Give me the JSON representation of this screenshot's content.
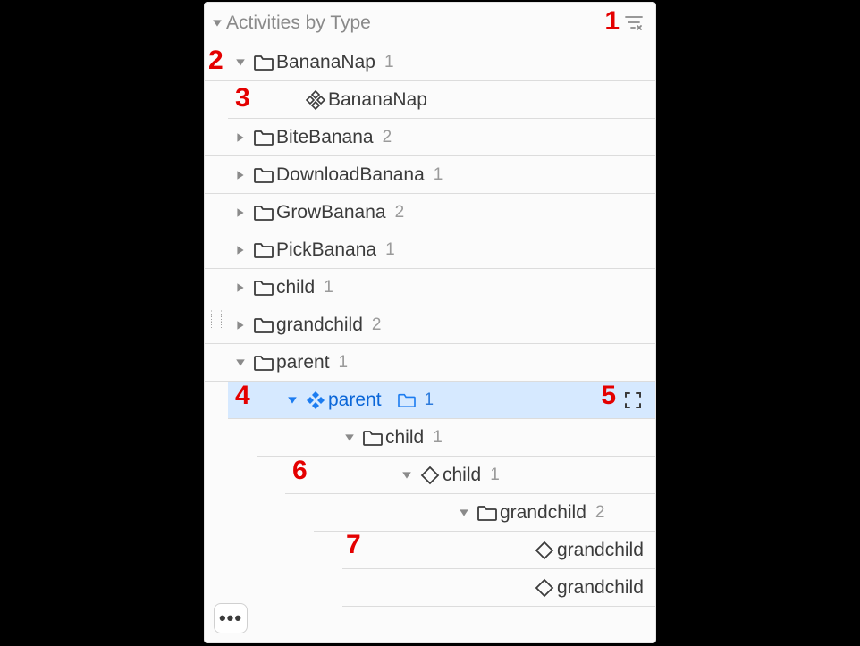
{
  "header": {
    "title": "Activities by Type"
  },
  "annotations": {
    "n1": "1",
    "n2": "2",
    "n3": "3",
    "n4": "4",
    "n5": "5",
    "n6": "6",
    "n7": "7"
  },
  "more_label": "•••",
  "rows": [
    {
      "indent": 28,
      "disclosure": "down",
      "icon": "folder",
      "label": "BananaNap",
      "count": "1"
    },
    {
      "indent": 60,
      "disclosure": "none",
      "icon": "diamond4",
      "label": "BananaNap",
      "count": ""
    },
    {
      "indent": 28,
      "disclosure": "right",
      "icon": "folder",
      "label": "BiteBanana",
      "count": "2"
    },
    {
      "indent": 28,
      "disclosure": "right",
      "icon": "folder",
      "label": "DownloadBanana",
      "count": "1"
    },
    {
      "indent": 28,
      "disclosure": "right",
      "icon": "folder",
      "label": "GrowBanana",
      "count": "2"
    },
    {
      "indent": 28,
      "disclosure": "right",
      "icon": "folder",
      "label": "PickBanana",
      "count": "1"
    },
    {
      "indent": 28,
      "disclosure": "right",
      "icon": "folder",
      "label": "child",
      "count": "1"
    },
    {
      "indent": 28,
      "disclosure": "right",
      "icon": "folder",
      "label": "grandchild",
      "count": "2"
    },
    {
      "indent": 28,
      "disclosure": "down",
      "icon": "folder",
      "label": "parent",
      "count": "1"
    },
    {
      "indent": 60,
      "disclosure": "down",
      "icon": "diamond4",
      "label": "parent",
      "count": "1",
      "selected": true,
      "trailing_folder_before_count": true,
      "focus": true
    },
    {
      "indent": 92,
      "disclosure": "down",
      "icon": "folder",
      "label": "child",
      "count": "1"
    },
    {
      "indent": 124,
      "disclosure": "down",
      "icon": "diamond",
      "label": "child",
      "count": "1"
    },
    {
      "indent": 156,
      "disclosure": "down",
      "icon": "folder",
      "label": "grandchild",
      "count": "2"
    },
    {
      "indent": 188,
      "disclosure": "none",
      "icon": "diamond",
      "label": "grandchild",
      "count": ""
    },
    {
      "indent": 188,
      "disclosure": "none",
      "icon": "diamond",
      "label": "grandchild",
      "count": ""
    }
  ]
}
